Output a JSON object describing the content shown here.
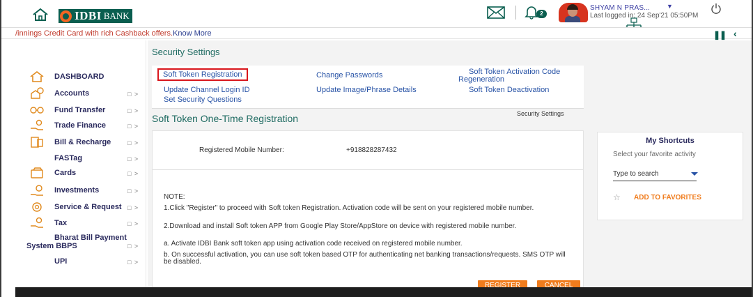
{
  "header": {
    "logo_text": "IDBI",
    "logo_suffix": "BANK",
    "notification_count": "2",
    "user_name": "SHYAM N PRAS...",
    "last_login": "Last logged in: 24 Sep'21 05:50PM"
  },
  "ticker": {
    "text": "/innings Credit Card with rich Cashback offers.",
    "link": "Know More"
  },
  "sidebar": {
    "items": [
      {
        "label": "DASHBOARD",
        "icon": "home-outline-icon",
        "arrow": ""
      },
      {
        "label": "Accounts",
        "icon": "accounts-icon",
        "arrow": "□ >"
      },
      {
        "label": "Fund Transfer",
        "icon": "fund-transfer-icon",
        "arrow": "□ >"
      },
      {
        "label": "Trade Finance",
        "icon": "trade-finance-icon",
        "arrow": "□ >"
      },
      {
        "label": "Bill & Recharge",
        "icon": "bill-recharge-icon",
        "arrow": "□ >"
      },
      {
        "label": "FASTag",
        "icon": "",
        "arrow": "□ >"
      },
      {
        "label": "Cards",
        "icon": "cards-icon",
        "arrow": "□ >"
      },
      {
        "label": "Investments",
        "icon": "investments-icon",
        "arrow": "□ >"
      },
      {
        "label": "Service & Request",
        "icon": "service-request-icon",
        "arrow": "□ >"
      },
      {
        "label": "Tax",
        "icon": "tax-icon",
        "arrow": "□ >"
      },
      {
        "label": "Bharat Bill Payment",
        "label2": "System BBPS",
        "icon": "",
        "arrow": "□ >"
      },
      {
        "label": "UPI",
        "icon": "",
        "arrow": "□ >"
      }
    ]
  },
  "main": {
    "section_title": "Security Settings",
    "links": {
      "soft_token_registration": "Soft Token Registration",
      "change_passwords": "Change Passwords",
      "soft_token_activation_1": "Soft Token Activation Code",
      "soft_token_activation_2": "Regeneration",
      "update_channel_login": "Update Channel Login ID",
      "update_image_phrase": "Update Image/Phrase Details",
      "soft_token_deactivation": "Soft Token Deactivation",
      "set_security_questions": "Set Security Questions"
    },
    "breadcrumb": "Security Settings",
    "form_title": "Soft Token One-Time Registration",
    "mobile_label": "Registered Mobile Number:",
    "mobile_value": "+918828287432",
    "note_title": "NOTE:",
    "notes": [
      "1.Click \"Register\" to proceed with Soft token Registration. Activation code will be sent on your registered mobile number.",
      "2.Download and install Soft token APP from Google Play Store/AppStore on device with registered mobile number.",
      "a. Activate IDBI Bank soft token app using activation code received on registered mobile number.",
      "b. On successful activation, you can use soft token based OTP for authenticating net banking transactions/requests. SMS OTP will be disabled."
    ],
    "register_label": "REGISTER",
    "cancel_label": "CANCEL"
  },
  "shortcuts": {
    "title": "My Shortcuts",
    "subtitle": "Select your favorite activity",
    "search_value": "Type to search",
    "add_label": "ADD TO FAVORITES"
  },
  "colors": {
    "brand_green": "#0a5e4f",
    "accent_orange": "#f07c1d",
    "link_blue": "#2853a6",
    "highlight_red": "#d9161c"
  }
}
